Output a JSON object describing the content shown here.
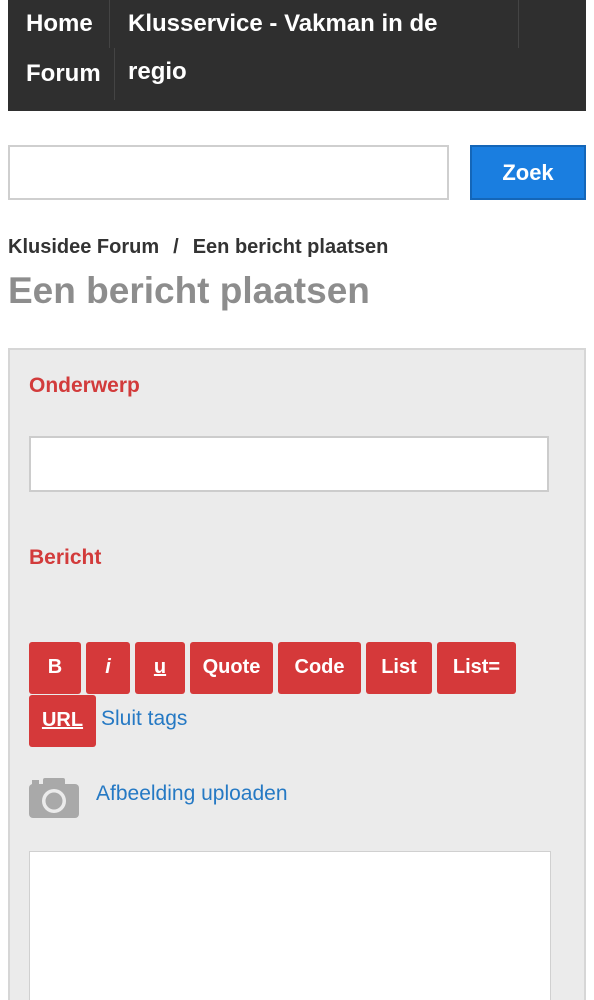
{
  "nav": {
    "home": "Home",
    "klusservice": "Klusservice - Vakman in de regio",
    "forum": "Forum"
  },
  "search": {
    "value": "",
    "placeholder": "",
    "button_label": "Zoek"
  },
  "breadcrumb": {
    "item1": "Klusidee Forum",
    "separator": "/",
    "item2": "Een bericht plaatsen"
  },
  "page_title": "Een bericht plaatsen",
  "form": {
    "subject_label": "Onderwerp",
    "subject_value": "",
    "message_label": "Bericht",
    "toolbar": {
      "bold": "B",
      "italic": "i",
      "underline": "u",
      "quote": "Quote",
      "code": "Code",
      "list": "List",
      "list_eq": "List=",
      "url": "URL"
    },
    "close_tags": "Sluit tags",
    "upload_label": "Afbeelding uploaden",
    "upload_icon": "camera-icon",
    "message_value": ""
  },
  "colors": {
    "nav_bg": "#2f2f2f",
    "search_button": "#1a7ee0",
    "toolbar_button": "#d5393a",
    "label_red": "#d23b3b",
    "link_blue": "#2579c4",
    "title_gray": "#8d8d8d",
    "panel_bg": "#ebebeb"
  }
}
